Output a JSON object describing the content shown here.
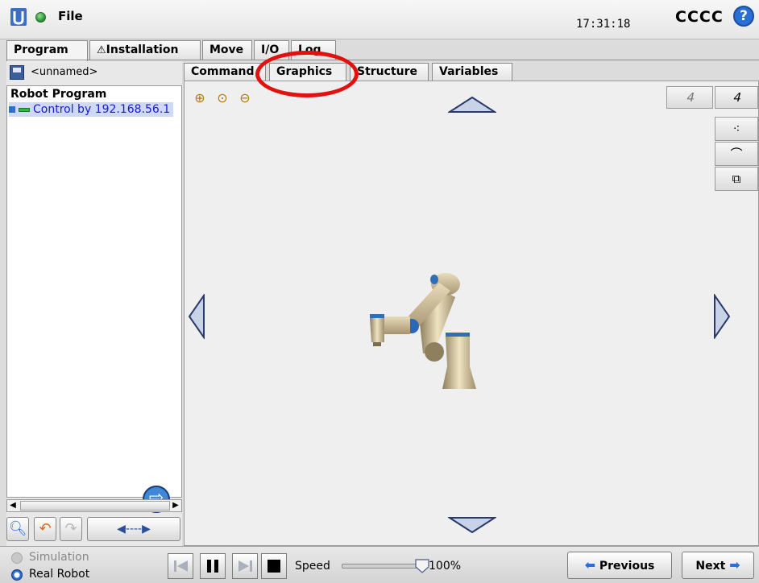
{
  "topbar": {
    "file_label": "File",
    "clock": "17:31:18",
    "robot_name": "CCCC",
    "help_label": "?"
  },
  "main_tabs": [
    {
      "label": "Program",
      "active": true
    },
    {
      "label": "Installation",
      "warning": true
    },
    {
      "label": "Move"
    },
    {
      "label": "I/O"
    },
    {
      "label": "Log"
    }
  ],
  "program": {
    "name": "<unnamed>",
    "tree_root": "Robot Program",
    "tree_items": [
      {
        "label": "Control by 192.168.56.1",
        "selected": true
      }
    ]
  },
  "sub_tabs": [
    {
      "label": "Command"
    },
    {
      "label": "Graphics",
      "active": true
    },
    {
      "label": "Structure"
    },
    {
      "label": "Variables"
    }
  ],
  "bottom": {
    "mode_simulation": "Simulation",
    "mode_real": "Real Robot",
    "speed_label": "Speed",
    "speed_value": "100%",
    "speed_fraction": 1.0,
    "previous_label": "Previous",
    "next_label": "Next"
  },
  "colors": {
    "accent_blue": "#2a6fd6",
    "highlight_ring": "#e31010",
    "selection": "#cfd8f5"
  }
}
